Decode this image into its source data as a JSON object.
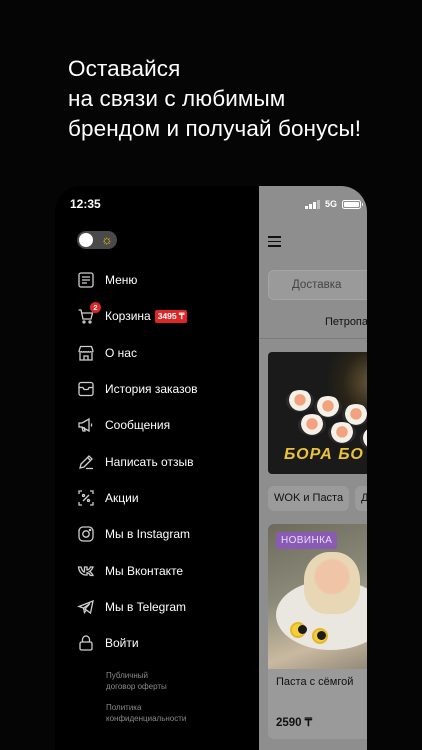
{
  "headline": [
    "Оставайся",
    "на связи с любимым",
    "брендом и получай бонусы!"
  ],
  "status": {
    "time": "12:35",
    "network": "5G"
  },
  "drawer": {
    "items": [
      {
        "label": "Меню",
        "icon": "menu-book-icon"
      },
      {
        "label": "Корзина",
        "icon": "cart-icon",
        "badge": "2",
        "total": "3495 ₸"
      },
      {
        "label": "О нас",
        "icon": "store-icon"
      },
      {
        "label": "История заказов",
        "icon": "order-history-icon"
      },
      {
        "label": "Сообщения",
        "icon": "megaphone-icon"
      },
      {
        "label": "Написать отзыв",
        "icon": "pencil-icon"
      },
      {
        "label": "Акции",
        "icon": "discount-icon"
      },
      {
        "label": "Мы в Instagram",
        "icon": "instagram-icon"
      },
      {
        "label": "Мы Вконтакте",
        "icon": "vk-icon"
      },
      {
        "label": "Мы в Telegram",
        "icon": "telegram-icon"
      },
      {
        "label": "Войти",
        "icon": "lock-icon"
      }
    ],
    "legal": {
      "offer": [
        "Публичный",
        "договор оферты"
      ],
      "privacy": [
        "Политика",
        "конфиденциальности"
      ]
    }
  },
  "app": {
    "delivery_label": "Доставка",
    "address": "Петропа",
    "banner_text": "БОРА БО",
    "categories": [
      "WOK и Паста",
      "Де"
    ],
    "card": {
      "badge": "НОВИНКА",
      "title": "Паста с сёмгой",
      "price": "2590 ₸"
    }
  },
  "colors": {
    "accent_red": "#e02525",
    "badge_purple": "#8a5bb3",
    "sun_yellow": "#f1c31c"
  }
}
